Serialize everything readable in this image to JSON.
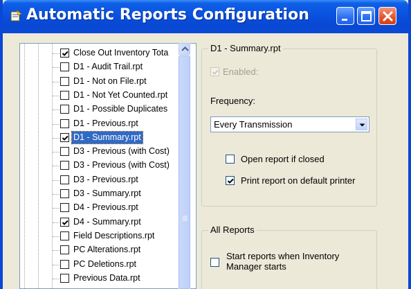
{
  "window": {
    "title": "Automatic Reports Configuration",
    "icon": "report-icon",
    "buttons": [
      "minimize-icon",
      "maximize-icon",
      "close-icon"
    ]
  },
  "tree": {
    "items": [
      {
        "label": "Close Out Inventory Tota",
        "checked": true,
        "selected": false
      },
      {
        "label": "D1 - Audit Trail.rpt",
        "checked": false,
        "selected": false
      },
      {
        "label": "D1 - Not on File.rpt",
        "checked": false,
        "selected": false
      },
      {
        "label": "D1 - Not Yet Counted.rpt",
        "checked": false,
        "selected": false
      },
      {
        "label": "D1 - Possible Duplicates",
        "checked": false,
        "selected": false
      },
      {
        "label": "D1 - Previous.rpt",
        "checked": false,
        "selected": false
      },
      {
        "label": "D1 - Summary.rpt",
        "checked": true,
        "selected": true
      },
      {
        "label": "D3 - Previous (with Cost)",
        "checked": false,
        "selected": false
      },
      {
        "label": "D3 - Previous (with Cost)",
        "checked": false,
        "selected": false
      },
      {
        "label": "D3 - Previous.rpt",
        "checked": false,
        "selected": false
      },
      {
        "label": "D3 - Summary.rpt",
        "checked": false,
        "selected": false
      },
      {
        "label": "D4 - Previous.rpt",
        "checked": false,
        "selected": false
      },
      {
        "label": "D4 - Summary.rpt",
        "checked": true,
        "selected": false
      },
      {
        "label": "Field Descriptions.rpt",
        "checked": false,
        "selected": false
      },
      {
        "label": "PC Alterations.rpt",
        "checked": false,
        "selected": false
      },
      {
        "label": "PC Deletions.rpt",
        "checked": false,
        "selected": false
      },
      {
        "label": "Previous Data.rpt",
        "checked": false,
        "selected": false
      }
    ]
  },
  "report_group": {
    "title": "D1 - Summary.rpt",
    "enabled_label": "Enabled:",
    "enabled_checked": true,
    "frequency_label": "Frequency:",
    "frequency_value": "Every Transmission",
    "open_if_closed_label": "Open report if closed",
    "open_if_closed_checked": false,
    "print_default_label": "Print report on default printer",
    "print_default_checked": true
  },
  "all_reports_group": {
    "title": "All Reports",
    "start_line1": "Start reports when Inventory",
    "start_line2": "Manager starts",
    "start_checked": false
  },
  "colors": {
    "titlebar": "#0a52df",
    "selection": "#316ac5",
    "window_face": "#ece9d8"
  }
}
